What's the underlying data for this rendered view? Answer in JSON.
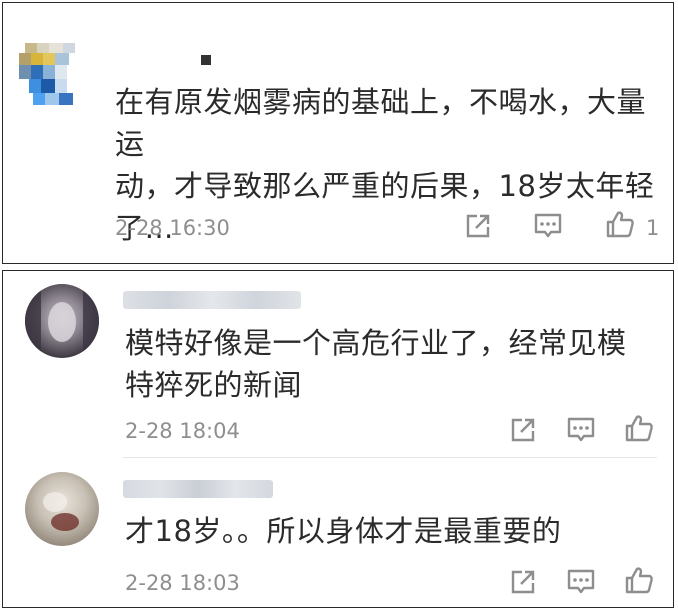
{
  "colors": {
    "text": "#2b2b2b",
    "meta": "#8e8e8e",
    "icon": "#8e8e8e",
    "border": "#2a2a2a"
  },
  "panels": [
    {
      "comments": [
        {
          "username": "",
          "avatar": "pixelated-avatar",
          "text_lines": [
            "在有原发烟雾病的基础上，不喝水，大量运",
            "动，才导致那么严重的后果，18岁太年轻",
            "了…"
          ],
          "timestamp": "2-28 16:30",
          "like_count": "1",
          "actions": [
            "share-icon",
            "reply-icon",
            "like-icon"
          ]
        }
      ]
    },
    {
      "comments": [
        {
          "username": "",
          "avatar": "blurred-avatar",
          "text_lines": [
            "模特好像是一个高危行业了，经常见模",
            "特猝死的新闻"
          ],
          "timestamp": "2-28 18:04",
          "like_count": "",
          "actions": [
            "share-icon",
            "reply-icon",
            "like-icon"
          ]
        },
        {
          "username": "",
          "avatar": "blurred-avatar",
          "text_lines": [
            "才18岁。。所以身体才是最重要的"
          ],
          "timestamp": "2-28 18:03",
          "like_count": "",
          "actions": [
            "share-icon",
            "reply-icon",
            "like-icon"
          ]
        }
      ]
    }
  ]
}
